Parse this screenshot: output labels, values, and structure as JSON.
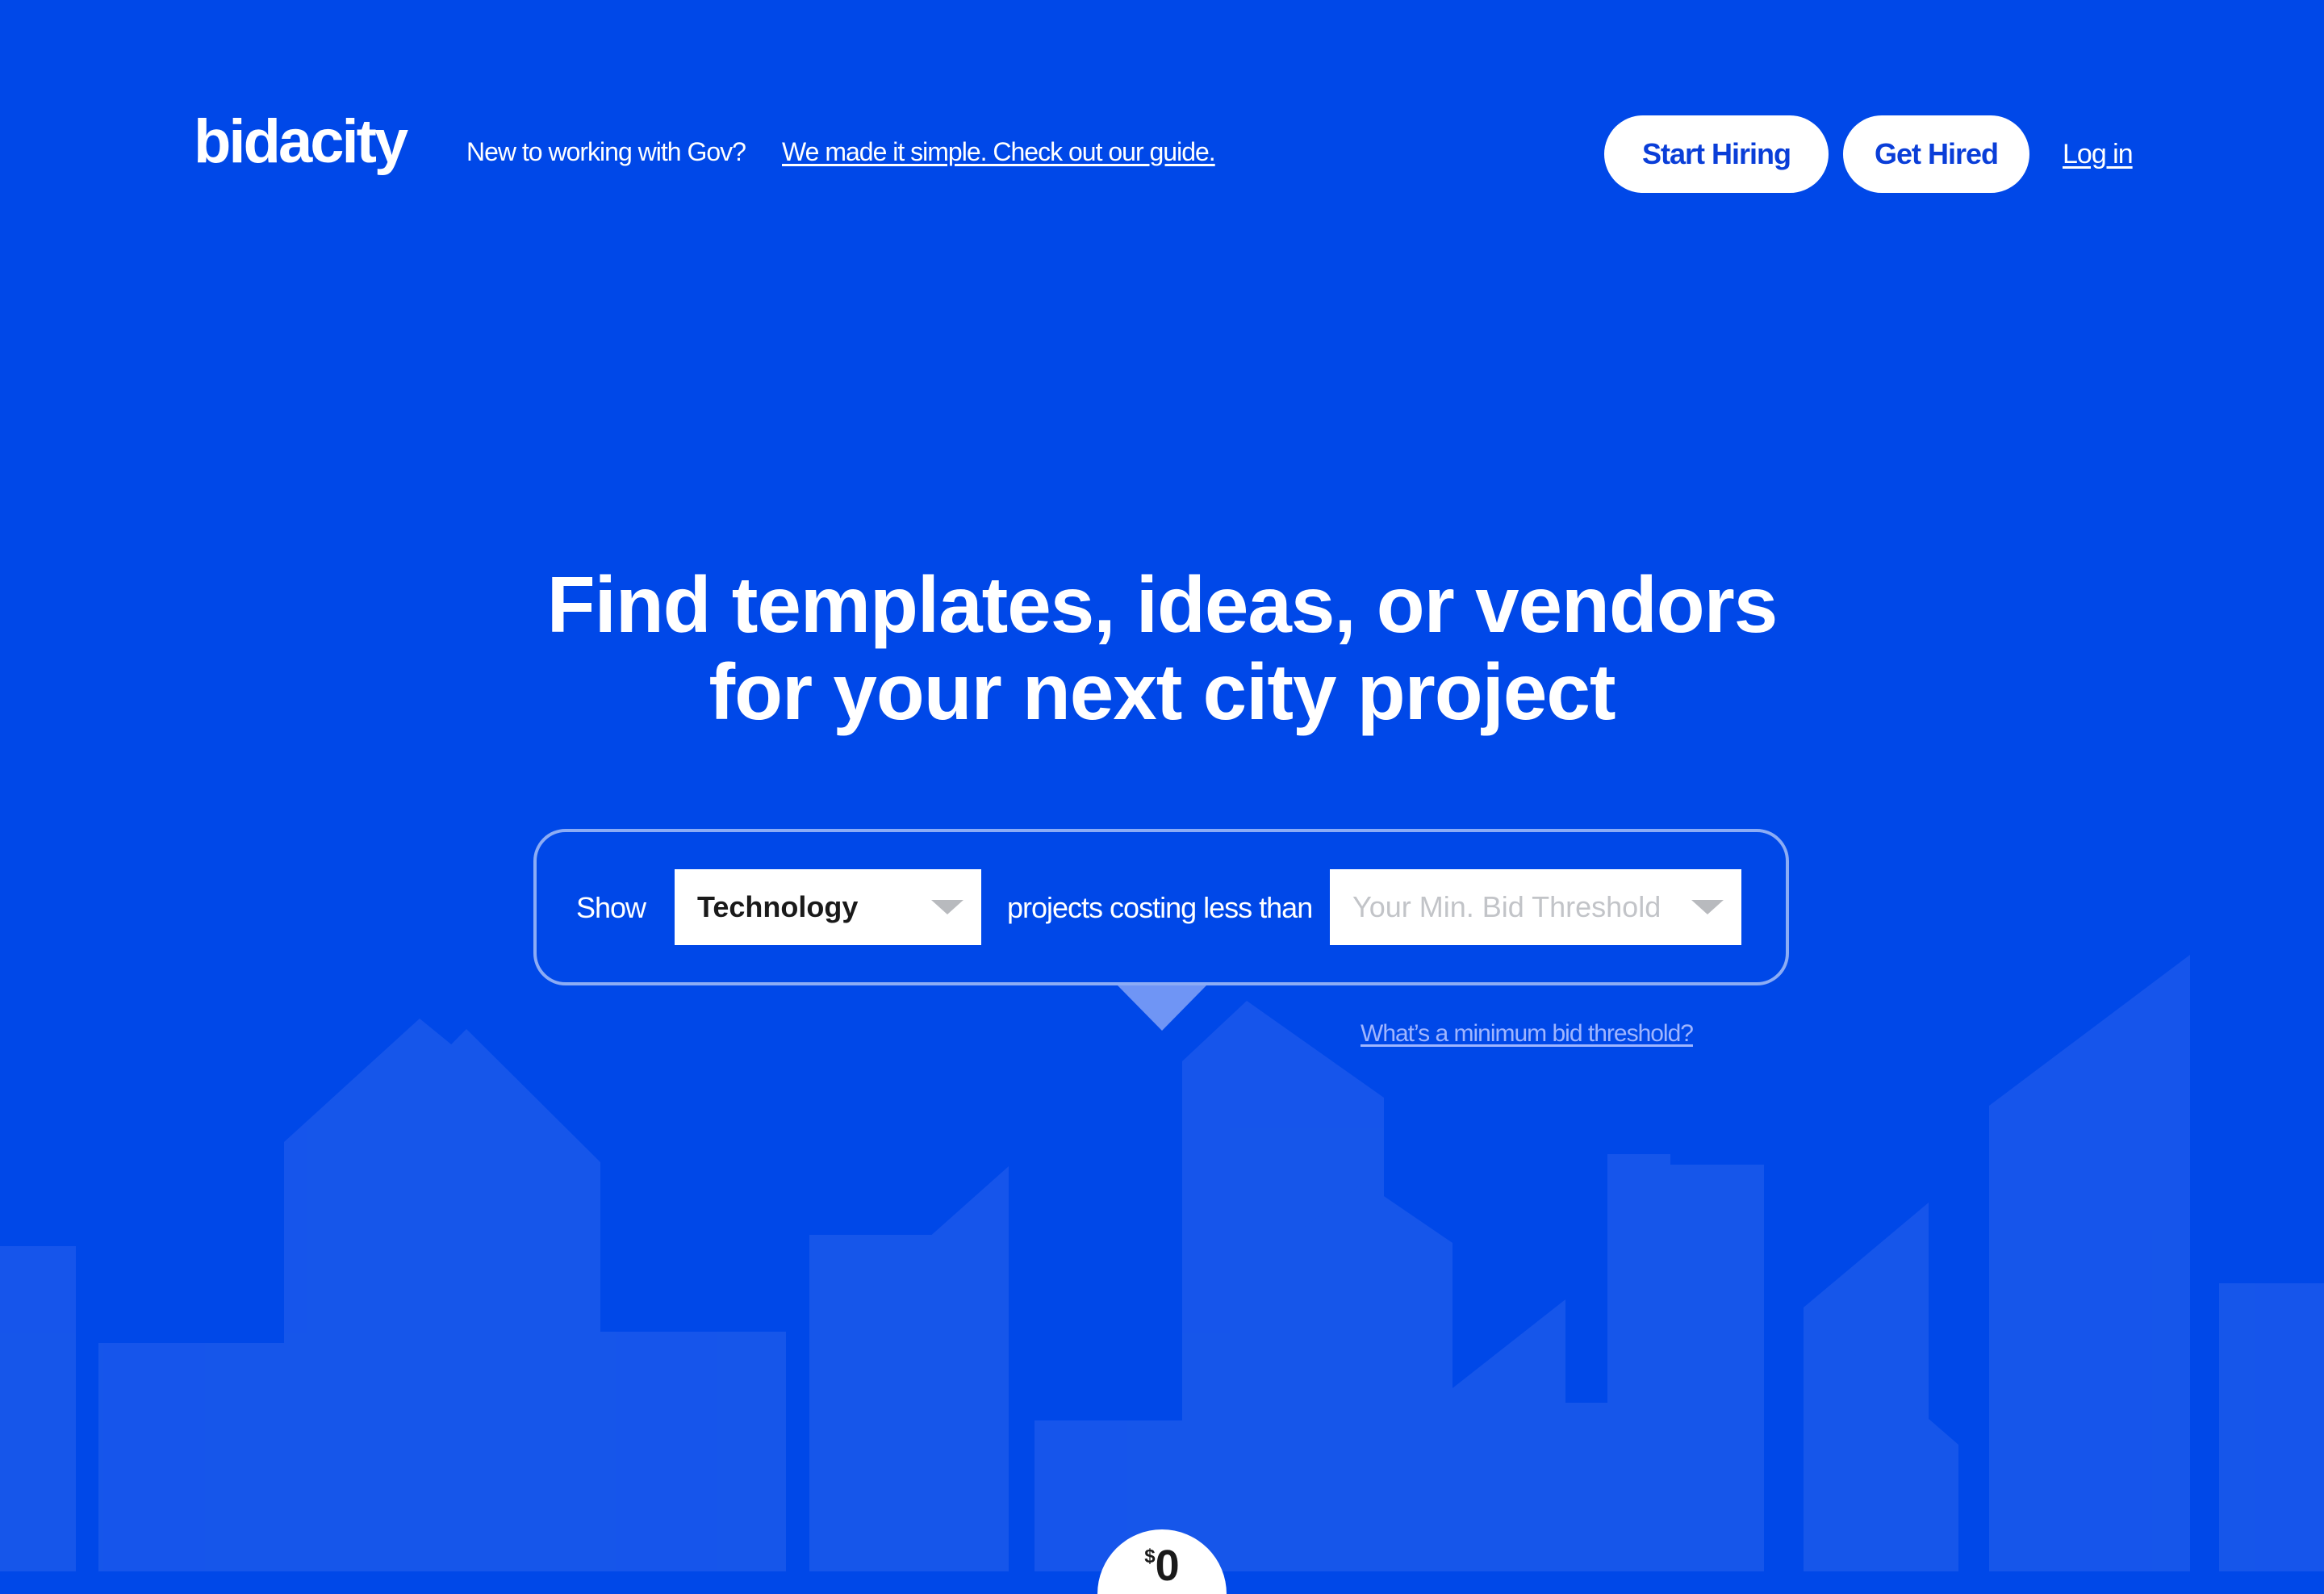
{
  "header": {
    "logo": "bidacity",
    "note": "New to working with Gov?",
    "guide_link": "We made it simple. Check out our guide.",
    "start_hiring": "Start Hiring",
    "get_hired": "Get Hired",
    "login": "Log in"
  },
  "hero": {
    "line1": "Find templates, ideas, or vendors",
    "line2": "for your next city project"
  },
  "filter": {
    "show_label": "Show",
    "category_value": "Technology",
    "middle_label": "projects costing less than",
    "threshold_placeholder": "Your Min. Bid Threshold",
    "help_link": "What’s a minimum bid threshold?"
  },
  "price_tab": {
    "currency": "$",
    "amount": "0"
  },
  "colors": {
    "background": "#0048e8",
    "button_text": "#0a3ed8",
    "building": "#3f71f0"
  }
}
